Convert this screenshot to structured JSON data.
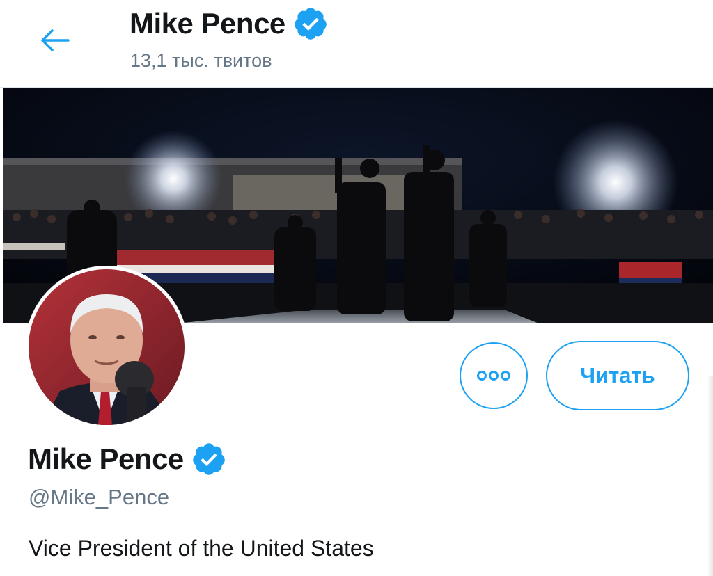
{
  "header": {
    "title": "Mike Pence",
    "tweet_count": "13,1 тыс. твитов",
    "back_icon": "arrow-left-icon"
  },
  "profile": {
    "name": "Mike Pence",
    "handle": "@Mike_Pence",
    "bio": "Vice President of the United States",
    "verified_icon": "verified-badge-icon"
  },
  "actions": {
    "more_icon": "more-options-icon",
    "follow_label": "Читать"
  },
  "colors": {
    "accent": "#1da1f2",
    "text_primary": "#14171a",
    "text_secondary": "#657786",
    "border": "#e1e8ed"
  }
}
